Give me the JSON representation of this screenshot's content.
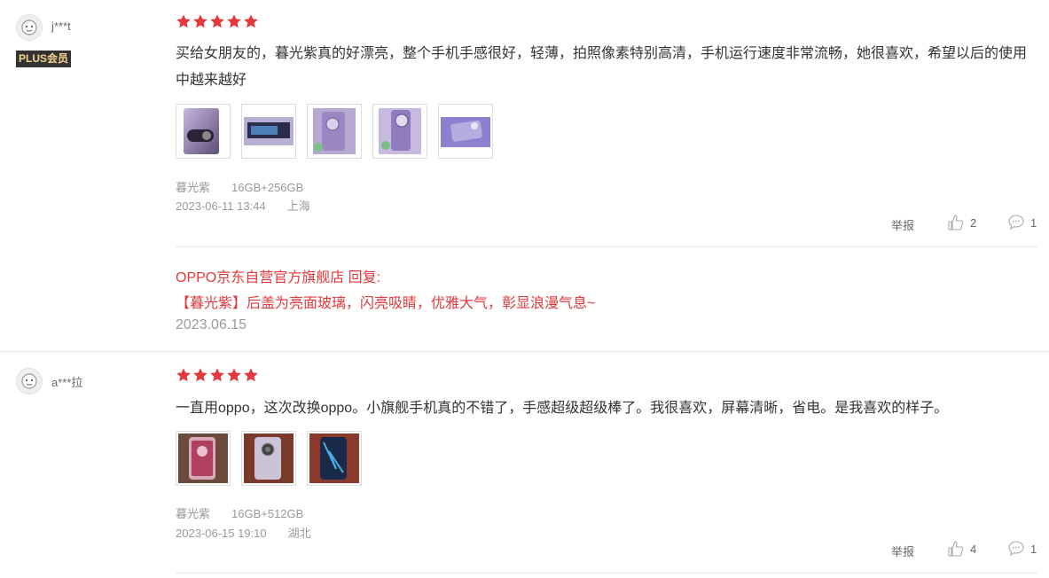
{
  "reviews": [
    {
      "username": "j***t",
      "badge": "PLUS会员",
      "rating": 5,
      "content": "买给女朋友的，暮光紫真的好漂亮，整个手机手感很好，轻薄，拍照像素特别高清，手机运行速度非常流畅，她很喜欢，希望以后的使用中越来越好",
      "photo_count": 5,
      "color": "暮光紫",
      "spec": "16GB+256GB",
      "datetime": "2023-06-11 13:44",
      "location": "上海",
      "report_label": "举报",
      "likes": "2",
      "comments": "1",
      "reply": {
        "title": "OPPO京东自营官方旗舰店 回复:",
        "text": "【暮光紫】后盖为亮面玻璃，闪亮吸睛，优雅大气，彰显浪漫气息~",
        "date": "2023.06.15"
      }
    },
    {
      "username": "a***拉",
      "rating": 5,
      "content": "一直用oppo，这次改换oppo。小旗舰手机真的不错了，手感超级超级棒了。我很喜欢，屏幕清晰，省电。是我喜欢的样子。",
      "photo_count": 3,
      "color": "暮光紫",
      "spec": "16GB+512GB",
      "datetime": "2023-06-15 19:10",
      "location": "湖北",
      "report_label": "举报",
      "likes": "4",
      "comments": "1"
    }
  ],
  "colors": {
    "star": "#e4393c",
    "reply": "#e4393c",
    "meta": "#999999"
  },
  "icons": {
    "like": "thumbs-up-icon",
    "comment": "comment-bubble-icon",
    "star": "star-icon"
  }
}
